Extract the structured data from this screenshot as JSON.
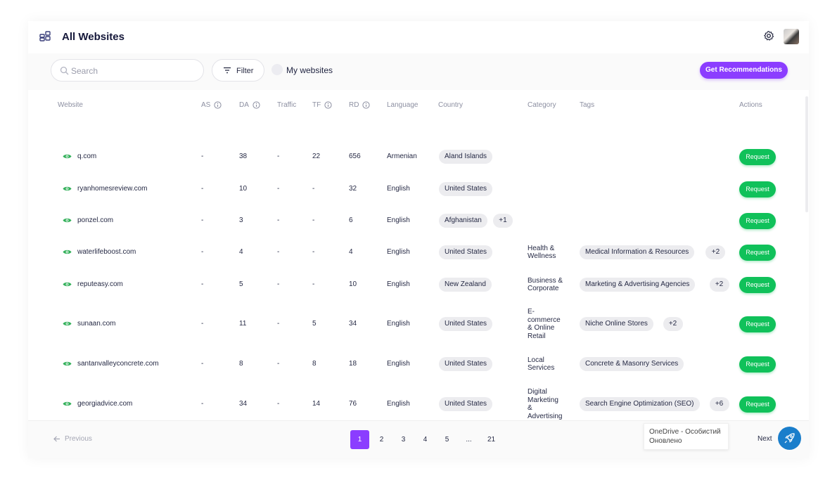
{
  "header": {
    "title": "All Websites",
    "app_icon": "grid-icon",
    "settings_icon": "gear-icon"
  },
  "toolbar": {
    "search_placeholder": "Search",
    "filter_label": "Filter",
    "my_websites_label": "My websites",
    "recommend_label": "Get Recommendations",
    "accent_color": "#8b3dff"
  },
  "columns": [
    "Website",
    "AS",
    "DA",
    "Traffic",
    "TF",
    "RD",
    "Language",
    "Country",
    "Category",
    "Tags",
    "Actions"
  ],
  "rows": [
    {
      "site": "q.com",
      "as": "-",
      "da": "38",
      "traffic": "-",
      "tf": "22",
      "rd": "656",
      "language": "Armenian",
      "country": "Aland Islands",
      "country_more": "",
      "category": [],
      "tag": "",
      "tag_more": "",
      "action": "Request"
    },
    {
      "site": "ryanhomesreview.com",
      "as": "-",
      "da": "10",
      "traffic": "-",
      "tf": "-",
      "rd": "32",
      "language": "English",
      "country": "United States",
      "country_more": "",
      "category": [],
      "tag": "",
      "tag_more": "",
      "action": "Request"
    },
    {
      "site": "ponzel.com",
      "as": "-",
      "da": "3",
      "traffic": "-",
      "tf": "-",
      "rd": "6",
      "language": "English",
      "country": "Afghanistan",
      "country_more": "+1",
      "category": [],
      "tag": "",
      "tag_more": "",
      "action": "Request"
    },
    {
      "site": "waterlifeboost.com",
      "as": "-",
      "da": "4",
      "traffic": "-",
      "tf": "-",
      "rd": "4",
      "language": "English",
      "country": "United States",
      "country_more": "",
      "category": [
        "Health &",
        "Wellness"
      ],
      "tag": "Medical Information & Resources",
      "tag_more": "+2",
      "action": "Request"
    },
    {
      "site": "reputeasy.com",
      "as": "-",
      "da": "5",
      "traffic": "-",
      "tf": "-",
      "rd": "10",
      "language": "English",
      "country": "New Zealand",
      "country_more": "",
      "category": [
        "Business &",
        "Corporate"
      ],
      "tag": "Marketing & Advertising Agencies",
      "tag_more": "+2",
      "action": "Request"
    },
    {
      "site": "sunaan.com",
      "as": "-",
      "da": "11",
      "traffic": "-",
      "tf": "5",
      "rd": "34",
      "language": "English",
      "country": "United States",
      "country_more": "",
      "category": [
        "E-",
        "commerce",
        "& Online",
        "Retail"
      ],
      "tag": "Niche Online Stores",
      "tag_more": "+2",
      "action": "Request"
    },
    {
      "site": "santanvalleyconcrete.com",
      "as": "-",
      "da": "8",
      "traffic": "-",
      "tf": "8",
      "rd": "18",
      "language": "English",
      "country": "United States",
      "country_more": "",
      "category": [
        "Local",
        "Services"
      ],
      "tag": "Concrete & Masonry Services",
      "tag_more": "",
      "action": "Request"
    },
    {
      "site": "georgiadvice.com",
      "as": "-",
      "da": "34",
      "traffic": "-",
      "tf": "14",
      "rd": "76",
      "language": "English",
      "country": "United States",
      "country_more": "",
      "category": [
        "Digital",
        "Marketing",
        "&",
        "Advertising"
      ],
      "tag": "Search Engine Optimization (SEO)",
      "tag_more": "+6",
      "action": "Request"
    }
  ],
  "pagination": {
    "prev_label": "Previous",
    "next_label": "Next",
    "pages": [
      "1",
      "2",
      "3",
      "4",
      "5",
      "...",
      "21"
    ],
    "active_page": "1"
  },
  "notification": {
    "line1": "OneDrive - Особистий",
    "line2": "Оновлено"
  },
  "colors": {
    "request_button": "#10c15a",
    "eye_icon": "#33b05a",
    "rocket_button": "#1a7ecb"
  }
}
